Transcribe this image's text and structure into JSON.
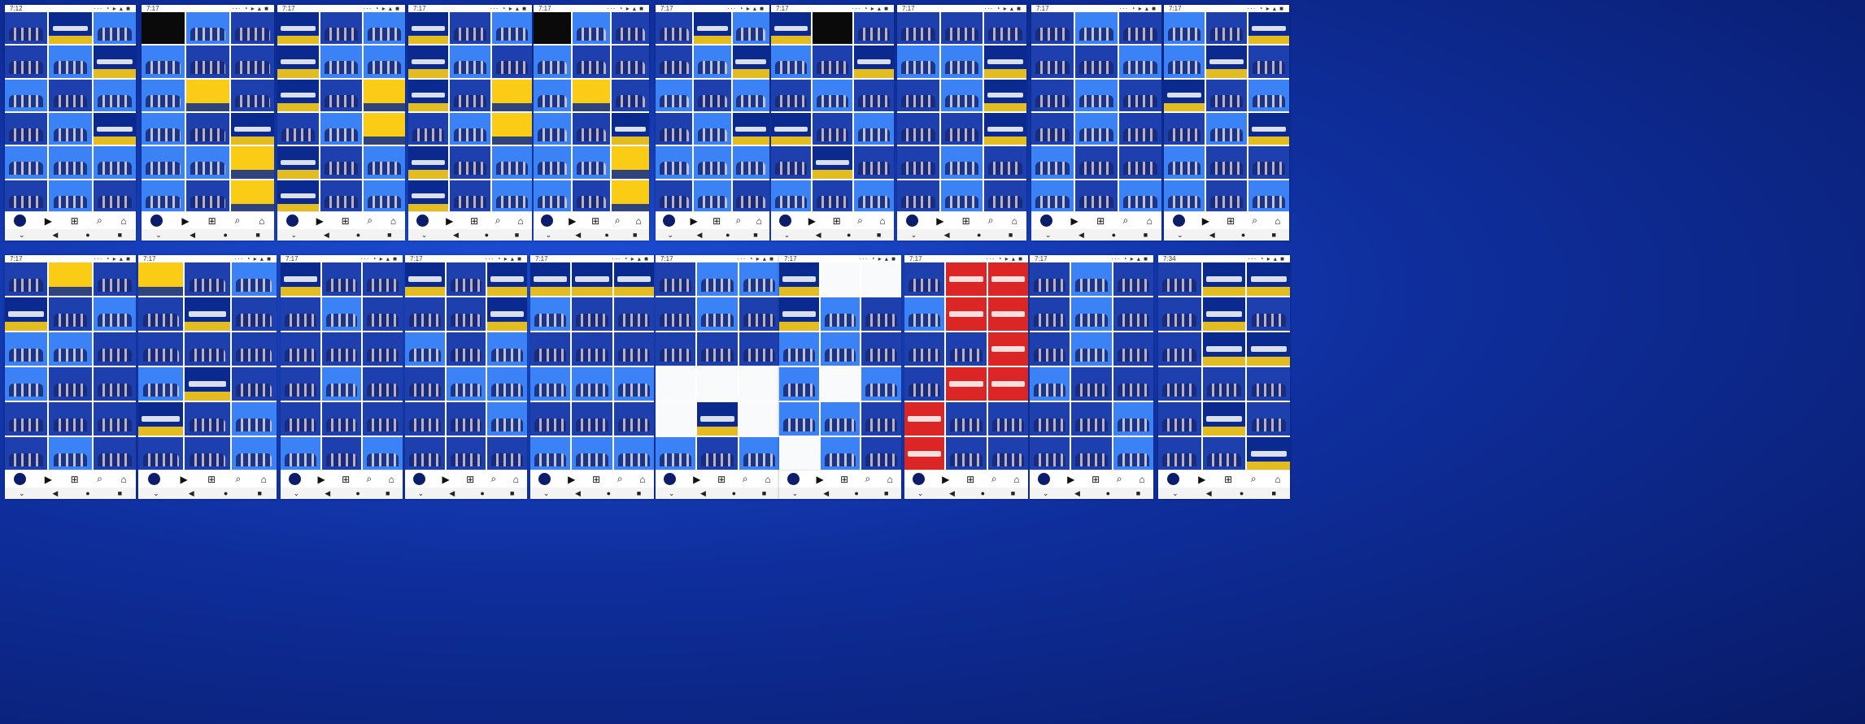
{
  "collage": {
    "rows": [
      {
        "phones": [
          {
            "time": "7:12",
            "tiles": [
              "team",
              "poster",
              "photo",
              "team",
              "photo",
              "poster",
              "photo",
              "team",
              "photo",
              "team",
              "photo",
              "poster",
              "photo",
              "photo",
              "photo",
              "team",
              "photo",
              "team"
            ]
          },
          {
            "time": "7:17",
            "tiles": [
              "dark",
              "photo",
              "team",
              "photo",
              "team",
              "team",
              "photo",
              "yellow",
              "team",
              "photo",
              "team",
              "poster",
              "photo",
              "photo",
              "yellow",
              "photo",
              "team",
              "yellow"
            ]
          },
          {
            "time": "7:17",
            "tiles": [
              "poster",
              "team",
              "photo",
              "poster",
              "photo",
              "photo",
              "poster",
              "team",
              "yellow",
              "team",
              "photo",
              "yellow",
              "poster",
              "team",
              "photo",
              "poster",
              "team",
              "photo"
            ]
          },
          {
            "time": "7:17",
            "tiles": [
              "poster",
              "team",
              "photo",
              "poster",
              "photo",
              "team",
              "poster",
              "team",
              "yellow",
              "team",
              "photo",
              "yellow",
              "poster",
              "team",
              "photo",
              "poster",
              "team",
              "photo"
            ]
          },
          {
            "time": "7:17",
            "tiles": [
              "dark",
              "photo",
              "team",
              "photo",
              "team",
              "team",
              "photo",
              "yellow",
              "team",
              "photo",
              "team",
              "poster",
              "photo",
              "photo",
              "yellow",
              "photo",
              "team",
              "yellow"
            ]
          },
          {
            "time": "7:17",
            "tiles": [
              "team",
              "poster",
              "photo",
              "team",
              "photo",
              "poster",
              "photo",
              "team",
              "photo",
              "team",
              "photo",
              "poster",
              "photo",
              "photo",
              "photo",
              "team",
              "photo",
              "team"
            ]
          },
          {
            "time": "7:17",
            "tiles": [
              "poster",
              "dark",
              "team",
              "photo",
              "team",
              "poster",
              "team",
              "photo",
              "team",
              "poster",
              "team",
              "photo",
              "team",
              "poster",
              "team",
              "photo",
              "team",
              "photo"
            ]
          },
          {
            "time": "7:17",
            "tiles": [
              "team",
              "team",
              "team",
              "photo",
              "photo",
              "poster",
              "team",
              "photo",
              "poster",
              "team",
              "team",
              "poster",
              "team",
              "photo",
              "team",
              "team",
              "photo",
              "team"
            ]
          },
          {
            "time": "7:17",
            "tiles": [
              "team",
              "photo",
              "team",
              "team",
              "team",
              "photo",
              "team",
              "photo",
              "team",
              "team",
              "photo",
              "team",
              "photo",
              "team",
              "team",
              "photo",
              "team",
              "photo"
            ]
          },
          {
            "time": "7:17",
            "tiles": [
              "photo",
              "team",
              "poster",
              "photo",
              "poster",
              "team",
              "poster",
              "team",
              "photo",
              "team",
              "photo",
              "poster",
              "photo",
              "team",
              "team",
              "photo",
              "team",
              "photo"
            ]
          }
        ]
      },
      {
        "phones": [
          {
            "time": "7:17",
            "tiles": [
              "team",
              "yellow",
              "team",
              "poster",
              "team",
              "photo",
              "photo",
              "photo",
              "team",
              "photo",
              "team",
              "team",
              "team",
              "team",
              "team",
              "team",
              "photo",
              "team"
            ]
          },
          {
            "time": "7:17",
            "tiles": [
              "yellow",
              "team",
              "photo",
              "team",
              "poster",
              "team",
              "team",
              "team",
              "team",
              "photo",
              "poster",
              "team",
              "poster",
              "team",
              "photo",
              "team",
              "team",
              "photo"
            ]
          },
          {
            "time": "7:17",
            "tiles": [
              "poster",
              "team",
              "team",
              "team",
              "photo",
              "team",
              "team",
              "team",
              "team",
              "team",
              "photo",
              "team",
              "team",
              "team",
              "team",
              "photo",
              "team",
              "photo"
            ]
          },
          {
            "time": "7:17",
            "tiles": [
              "poster",
              "team",
              "poster",
              "team",
              "team",
              "poster",
              "photo",
              "team",
              "photo",
              "team",
              "photo",
              "photo",
              "team",
              "team",
              "photo",
              "team",
              "team",
              "team"
            ]
          },
          {
            "time": "7:17",
            "tiles": [
              "poster",
              "poster",
              "poster",
              "photo",
              "team",
              "team",
              "team",
              "team",
              "team",
              "photo",
              "photo",
              "photo",
              "team",
              "team",
              "team",
              "photo",
              "photo",
              "photo"
            ]
          },
          {
            "time": "7:17",
            "tiles": [
              "team",
              "photo",
              "photo",
              "team",
              "photo",
              "team",
              "team",
              "team",
              "team",
              "white",
              "white",
              "white",
              "white",
              "poster",
              "white",
              "photo",
              "team",
              "photo"
            ]
          },
          {
            "time": "7:17",
            "tiles": [
              "poster",
              "white",
              "white",
              "poster",
              "photo",
              "team",
              "photo",
              "photo",
              "team",
              "photo",
              "white",
              "photo",
              "photo",
              "photo",
              "team",
              "white",
              "photo",
              "team"
            ]
          },
          {
            "time": "7:17",
            "tiles": [
              "team",
              "red",
              "red",
              "photo",
              "red",
              "red",
              "team",
              "team",
              "red",
              "team",
              "red",
              "red",
              "red",
              "team",
              "team",
              "red",
              "team",
              "team"
            ]
          },
          {
            "time": "7:17",
            "tiles": [
              "team",
              "photo",
              "team",
              "team",
              "photo",
              "team",
              "team",
              "photo",
              "team",
              "photo",
              "team",
              "team",
              "team",
              "team",
              "photo",
              "team",
              "team",
              "photo"
            ]
          },
          {
            "time": "7:34",
            "tiles": [
              "team",
              "poster",
              "poster",
              "team",
              "poster",
              "team",
              "team",
              "poster",
              "poster",
              "team",
              "team",
              "team",
              "team",
              "poster",
              "team",
              "team",
              "team",
              "poster"
            ]
          }
        ]
      }
    ]
  },
  "nav": {
    "home": "⌂",
    "search": "⌕",
    "create": "⊞",
    "reels": "▶",
    "profile": ""
  },
  "system_nav": {
    "back": "◀",
    "home_btn": "●",
    "recents": "■",
    "down": "⌄"
  },
  "status": {
    "icons": "··· ◔ ▸ ▴ ■"
  },
  "colors": {
    "photo": "#3b82f6",
    "team": "#1e40af",
    "poster": "#0b2a8f",
    "dark": "#0a0a0a",
    "yellow": "#facc15",
    "white": "#f8fafc",
    "red": "#dc2626"
  }
}
